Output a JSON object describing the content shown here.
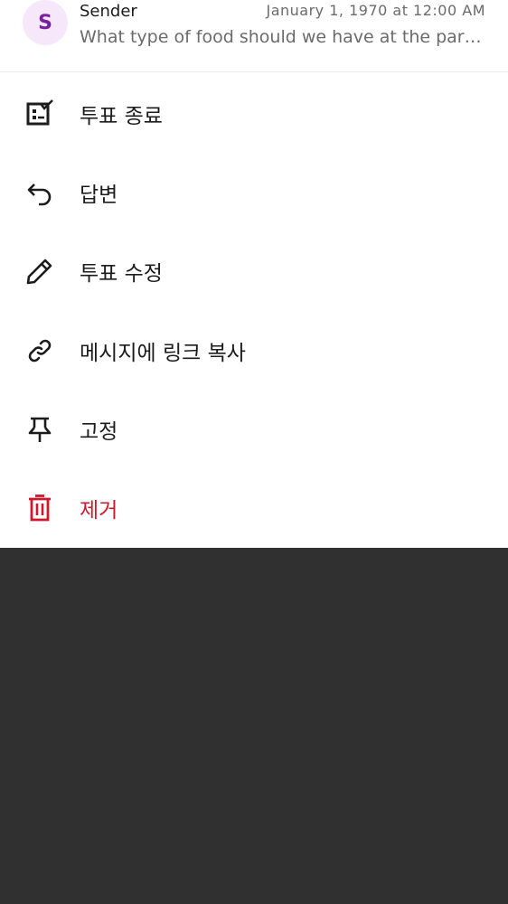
{
  "message": {
    "avatar_letter": "S",
    "sender": "Sender",
    "timestamp": "January 1, 1970 at 12:00 AM",
    "preview": "What type of food should we have at the party?"
  },
  "menu": [
    {
      "label": "투표 종료",
      "icon": "poll-end-icon"
    },
    {
      "label": "답변",
      "icon": "reply-icon"
    },
    {
      "label": "투표 수정",
      "icon": "pencil-icon"
    },
    {
      "label": "메시지에 링크 복사",
      "icon": "link-icon"
    },
    {
      "label": "고정",
      "icon": "pin-icon"
    },
    {
      "label": "제거",
      "icon": "trash-icon"
    }
  ],
  "colors": {
    "danger": "#d0182b",
    "avatar_bg": "#f6e7fa",
    "avatar_text": "#7b1fa2",
    "scrim": "#303030"
  }
}
